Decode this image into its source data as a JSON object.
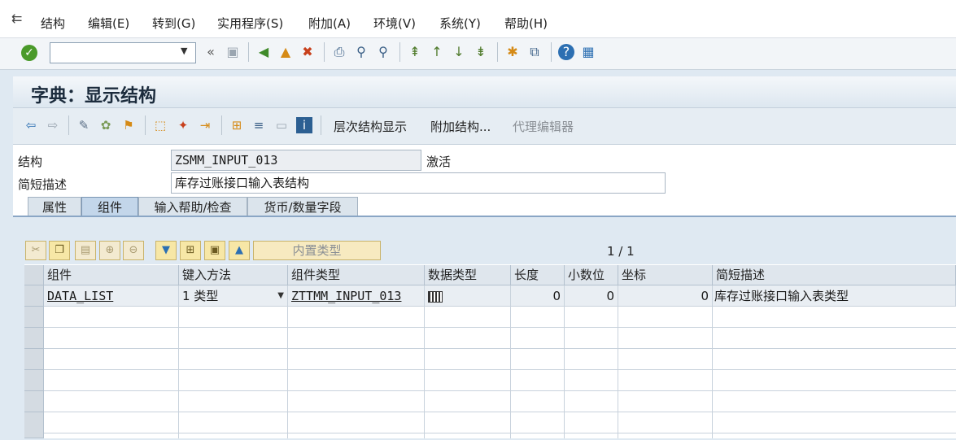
{
  "menu": {
    "items": [
      "结构",
      "编辑(E)",
      "转到(G)",
      "实用程序(S)",
      "附加(A)",
      "环境(V)",
      "系统(Y)",
      "帮助(H)"
    ]
  },
  "toolbar": {
    "command_value": "",
    "back_glyph": "«"
  },
  "title": "字典：显示结构",
  "app_toolbar": {
    "buttons": [
      "层次结构显示",
      "附加结构...",
      "代理编辑器"
    ]
  },
  "form": {
    "structure_label": "结构",
    "structure_value": "ZSMM_INPUT_013",
    "status": "激活",
    "short_desc_label": "简短描述",
    "short_desc_value": "库存过账接口输入表结构"
  },
  "tabs": [
    "属性",
    "组件",
    "输入帮助/检查",
    "货币/数量字段"
  ],
  "active_tab": "组件",
  "grid": {
    "builtin_type_label": "内置类型",
    "page_info": "1 / 1",
    "columns": [
      "组件",
      "键入方法",
      "组件类型",
      "数据类型",
      "长度",
      "小数位",
      "坐标",
      "简短描述"
    ],
    "rows": [
      {
        "component": "DATA_LIST",
        "typing_method": "1 类型",
        "component_type": "ZTTMM_INPUT_013",
        "data_type_icon": "table-type-icon",
        "length": "0",
        "decimals": "0",
        "coordinate": "0",
        "short_desc": "库存过账接口输入表类型"
      }
    ]
  }
}
